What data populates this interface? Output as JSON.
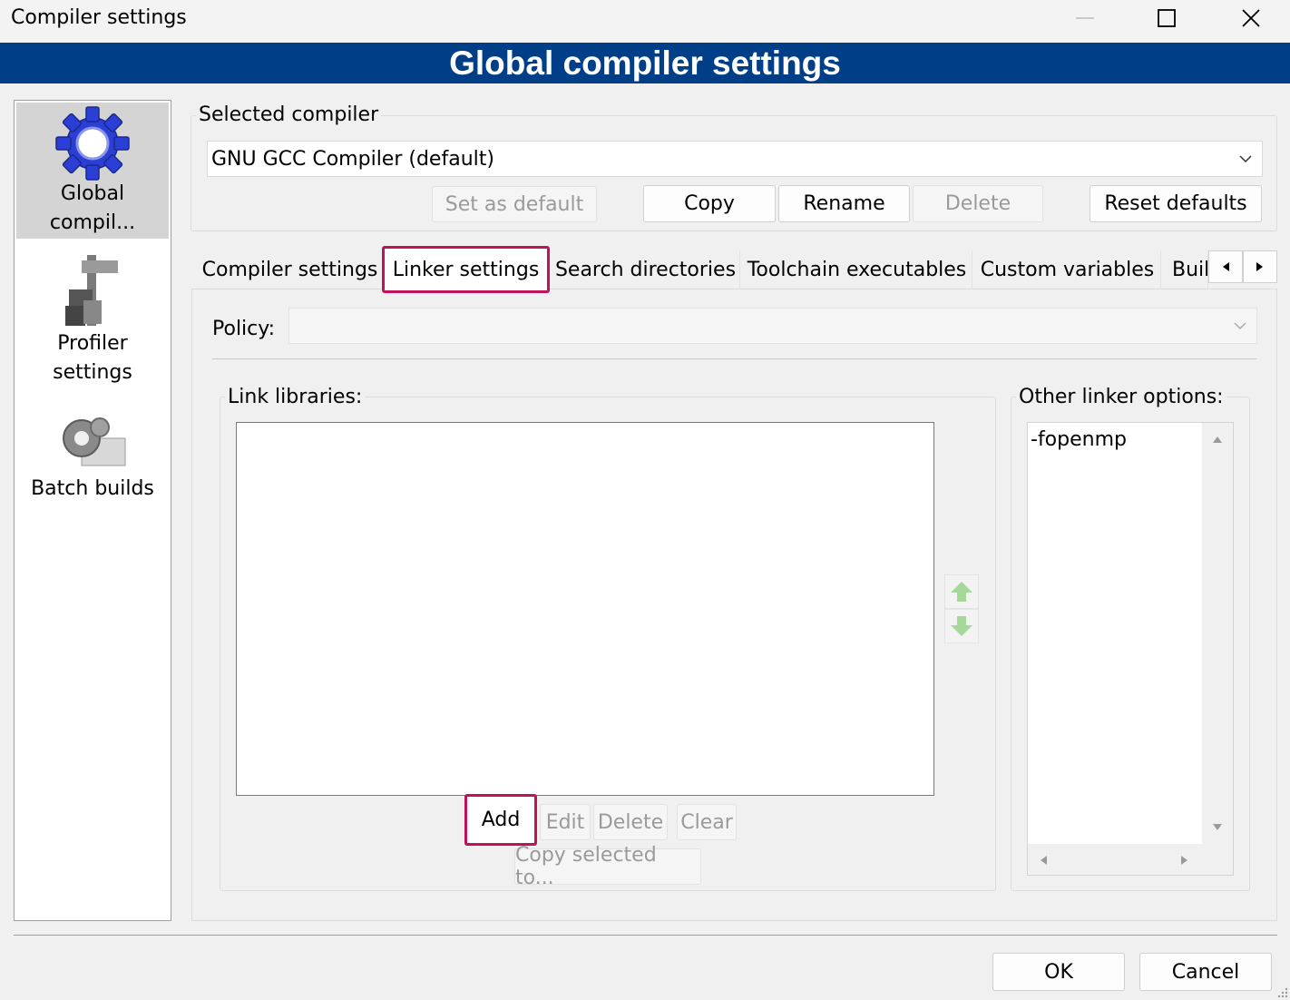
{
  "window": {
    "title": "Compiler settings"
  },
  "banner": {
    "title": "Global compiler settings"
  },
  "sidebar": {
    "items": [
      {
        "label": "Global compil...",
        "icon": "gear-icon"
      },
      {
        "label": "Profiler settings",
        "icon": "caliper-icon"
      },
      {
        "label": "Batch builds",
        "icon": "gears-stack-icon"
      }
    ]
  },
  "selected_compiler": {
    "group_label": "Selected compiler",
    "value": "GNU GCC Compiler (default)",
    "buttons": {
      "set_default": "Set as default",
      "copy": "Copy",
      "rename": "Rename",
      "delete": "Delete",
      "reset": "Reset defaults"
    }
  },
  "tabs": [
    {
      "label": "Compiler settings"
    },
    {
      "label": "Linker settings",
      "active": true
    },
    {
      "label": "Search directories"
    },
    {
      "label": "Toolchain executables"
    },
    {
      "label": "Custom variables"
    },
    {
      "label": "Buil"
    }
  ],
  "linker": {
    "policy_label": "Policy:",
    "policy_value": "",
    "link_libraries_label": "Link libraries:",
    "buttons": {
      "add": "Add",
      "edit": "Edit",
      "delete": "Delete",
      "clear": "Clear",
      "copy_selected": "Copy selected to..."
    },
    "other_options_label": "Other linker options:",
    "other_options_text": "-fopenmp"
  },
  "dialog": {
    "ok": "OK",
    "cancel": "Cancel"
  },
  "colors": {
    "banner": "#003f87",
    "highlight": "#c0125a"
  }
}
